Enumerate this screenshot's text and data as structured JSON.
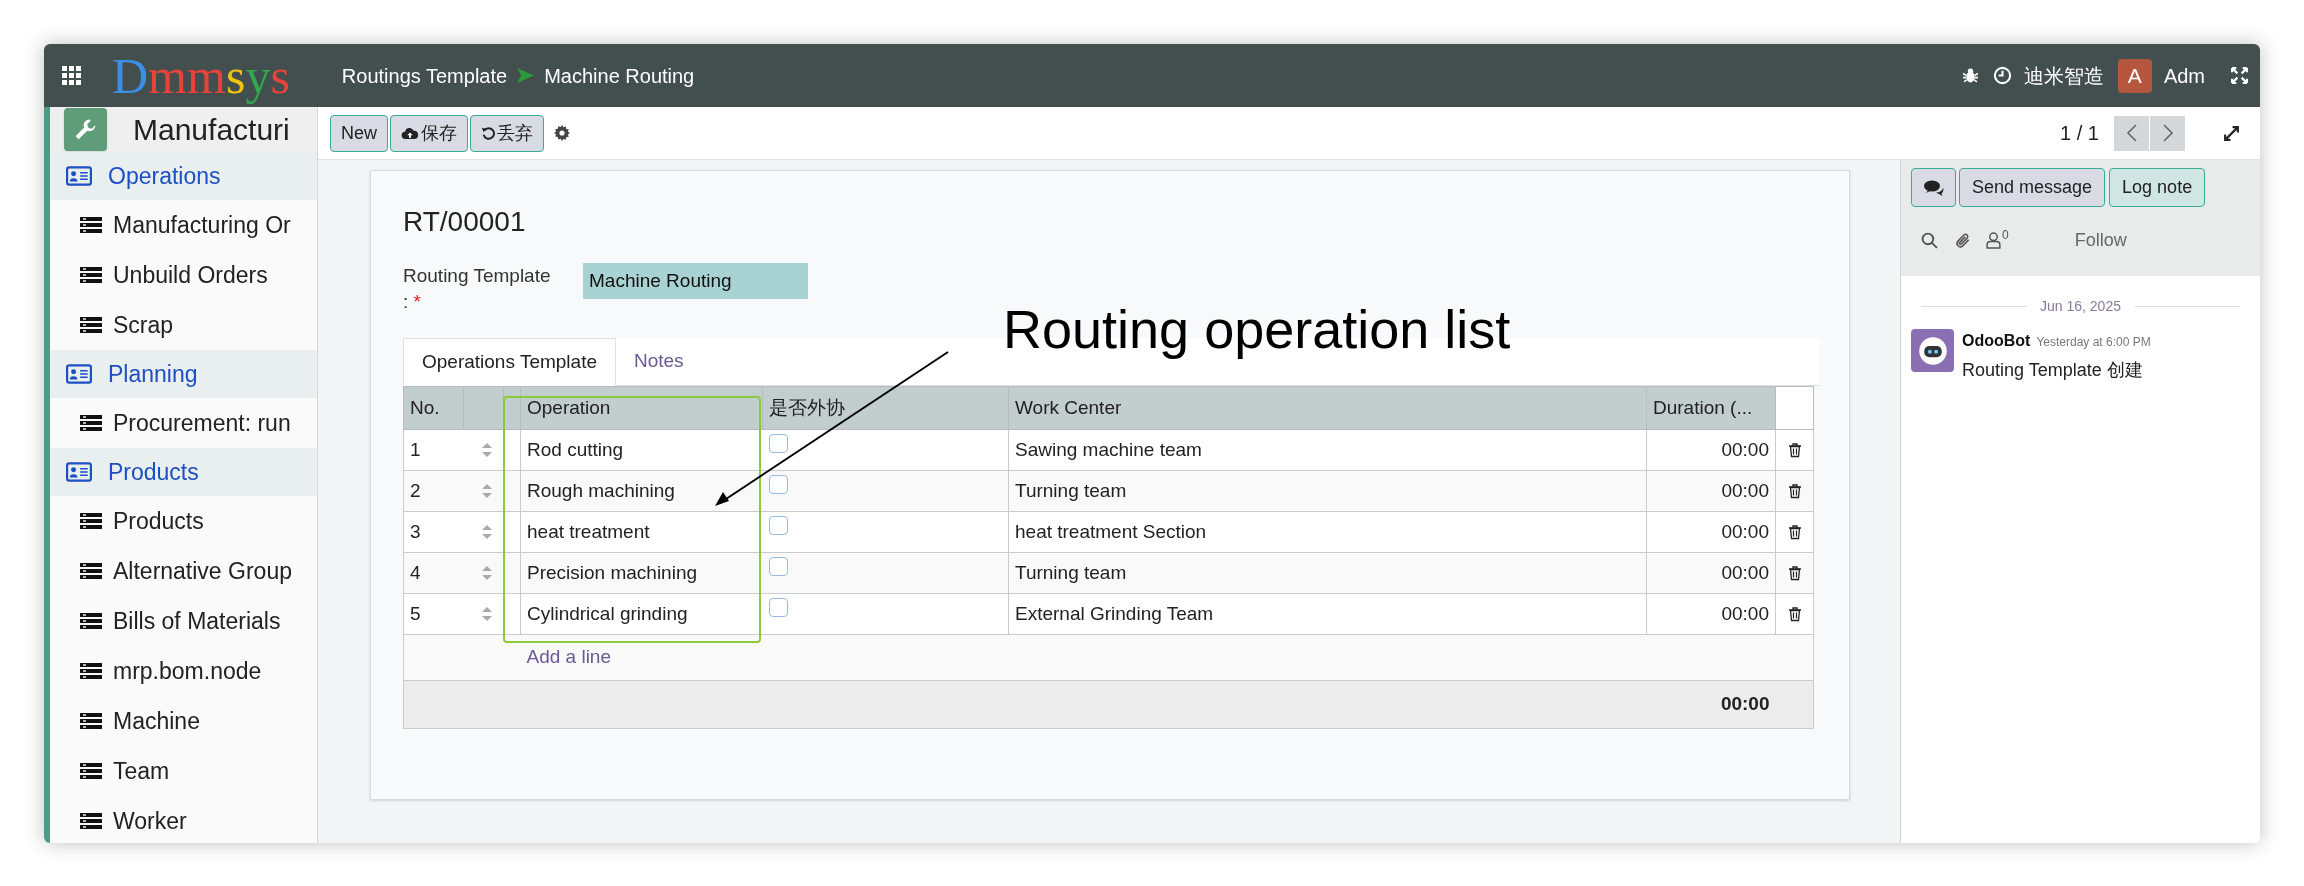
{
  "navbar": {
    "logo": "Dmmsys",
    "breadcrumbs": [
      "Routings Template",
      "Machine Routing"
    ],
    "company": "迪米智造",
    "avatar_letter": "A",
    "user": "Adm"
  },
  "sidebar": {
    "app_title": "Manufacturi",
    "sections": [
      {
        "label": "Operations",
        "items": [
          "Manufacturing Or",
          "Unbuild Orders",
          "Scrap"
        ]
      },
      {
        "label": "Planning",
        "items": [
          "Procurement: run"
        ]
      },
      {
        "label": "Products",
        "items": [
          "Products",
          "Alternative Group",
          "Bills of Materials",
          "mrp.bom.node",
          "Machine",
          "Team",
          "Worker"
        ]
      }
    ]
  },
  "toolbar": {
    "buttons": [
      {
        "label": "New",
        "kind": "new"
      },
      {
        "label": "保存",
        "kind": "save"
      },
      {
        "label": "丢弃",
        "kind": "discard"
      }
    ],
    "pager": "1 / 1"
  },
  "form": {
    "reference": "RT/00001",
    "field_label": "Routing Template :",
    "required_mark": "*",
    "field_value": "Machine Routing",
    "tabs": [
      {
        "label": "Operations Template",
        "selected": true
      },
      {
        "label": "Notes",
        "selected": false
      }
    ],
    "table": {
      "columns": [
        "No.",
        "Operation",
        "是否外协",
        "Work Center",
        "Duration (..."
      ],
      "rows": [
        {
          "no": "1",
          "operation": "Rod cutting",
          "outsourced": false,
          "work_center": "Sawing machine team",
          "duration": "00:00"
        },
        {
          "no": "2",
          "operation": "Rough machining",
          "outsourced": false,
          "work_center": "Turning team",
          "duration": "00:00"
        },
        {
          "no": "3",
          "operation": "heat treatment",
          "outsourced": false,
          "work_center": "heat treatment Section",
          "duration": "00:00"
        },
        {
          "no": "4",
          "operation": "Precision machining",
          "outsourced": false,
          "work_center": "Turning team",
          "duration": "00:00"
        },
        {
          "no": "5",
          "operation": "Cylindrical grinding",
          "outsourced": false,
          "work_center": "External Grinding Team",
          "duration": "00:00"
        }
      ],
      "add_line": "Add a line",
      "total": "00:00"
    }
  },
  "annotation": {
    "text": "Routing operation list"
  },
  "chatter": {
    "buttons": [
      "Send message",
      "Log note"
    ],
    "follower_count": "0",
    "follow": "Follow",
    "date": "Jun 16, 2025",
    "messages": [
      {
        "author": "OdooBot",
        "time": "Yesterday at 6:00 PM",
        "body": "Routing Template 创建"
      }
    ]
  }
}
